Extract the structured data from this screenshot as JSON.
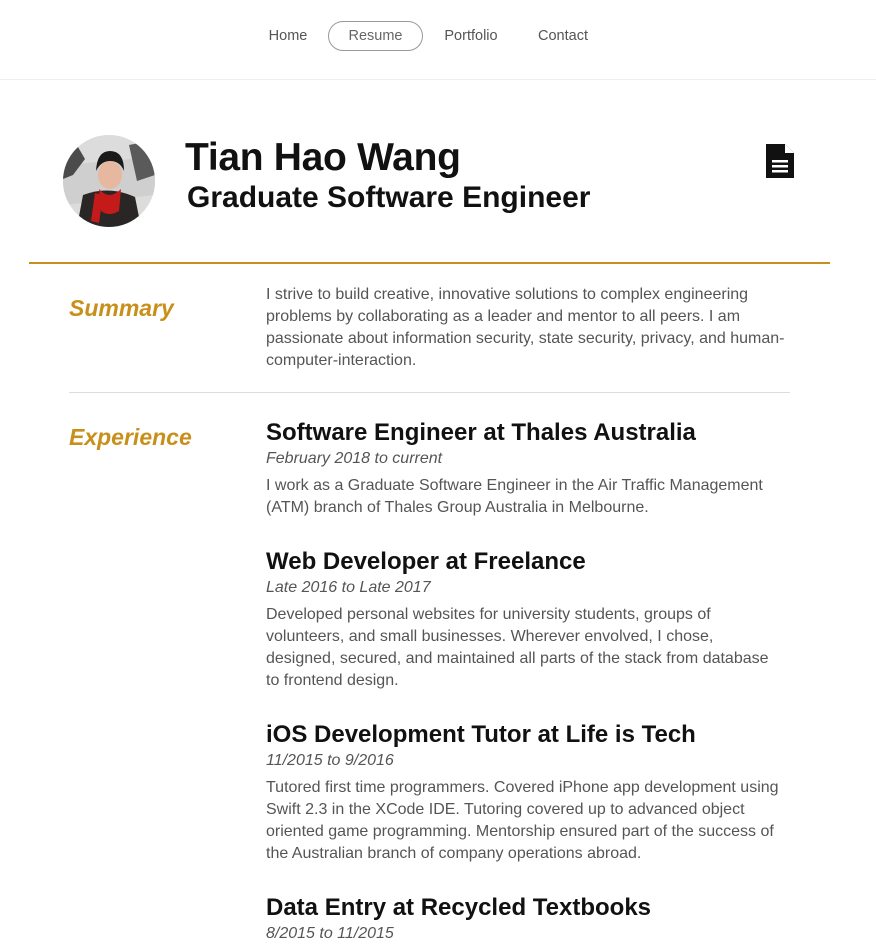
{
  "nav": {
    "items": [
      {
        "label": "Home"
      },
      {
        "label": "Resume"
      },
      {
        "label": "Portfolio"
      },
      {
        "label": "Contact"
      }
    ]
  },
  "header": {
    "name": "Tian Hao Wang",
    "role": "Graduate Software Engineer",
    "doc_icon": "document-icon",
    "accent_color": "#c8901b"
  },
  "summary": {
    "label": "Summary",
    "text": "I strive to build creative, innovative solutions to complex engineering problems by collaborating as a leader and mentor to all peers. I am passionate about information security, state security, privacy, and human-computer-interaction."
  },
  "experience": {
    "label": "Experience",
    "jobs": [
      {
        "title": "Software Engineer at Thales Australia",
        "date": "February 2018 to current",
        "desc": "I work as a Graduate Software Engineer in the Air Traffic Management (ATM) branch of Thales Group Australia in Melbourne."
      },
      {
        "title": "Web Developer at Freelance",
        "date": "Late 2016 to Late 2017",
        "desc": "Developed personal websites for university students, groups of volunteers, and small businesses. Wherever envolved, I chose, designed, secured, and maintained all parts of the stack from database to frontend design."
      },
      {
        "title": "iOS Development Tutor at Life is Tech",
        "date": "11/2015 to 9/2016",
        "desc": "Tutored first time programmers. Covered iPhone app development using Swift 2.3 in the XCode IDE. Tutoring covered up to advanced object oriented game programming. Mentorship ensured part of the success of the Australian branch of company operations abroad."
      },
      {
        "title": "Data Entry at Recycled Textbooks",
        "date": "8/2015 to 11/2015",
        "desc": ""
      }
    ]
  }
}
